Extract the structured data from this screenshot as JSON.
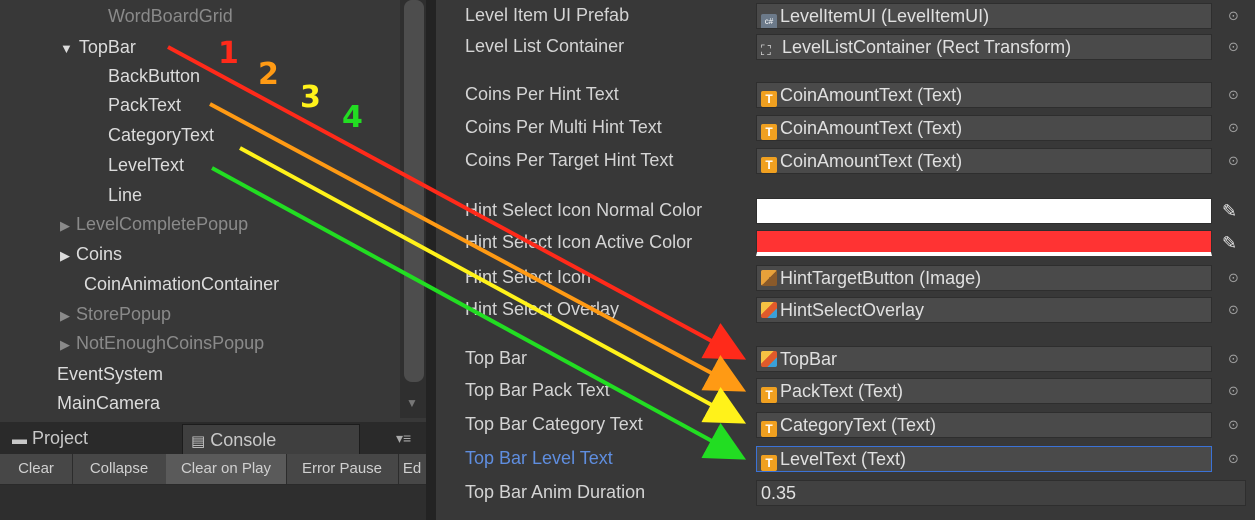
{
  "hierarchy": {
    "items": [
      {
        "label": "WordBoardGrid",
        "dim": true
      },
      {
        "label": "TopBar"
      },
      {
        "label": "BackButton"
      },
      {
        "label": "PackText"
      },
      {
        "label": "CategoryText"
      },
      {
        "label": "LevelText"
      },
      {
        "label": "Line"
      },
      {
        "label": "LevelCompletePopup",
        "dim": true
      },
      {
        "label": "Coins"
      },
      {
        "label": "CoinAnimationContainer"
      },
      {
        "label": "StorePopup",
        "dim": true
      },
      {
        "label": "NotEnoughCoinsPopup",
        "dim": true
      },
      {
        "label": "EventSystem"
      },
      {
        "label": "MainCamera"
      }
    ]
  },
  "tabs": {
    "project": "Project",
    "console": "Console"
  },
  "console_toolbar": [
    "Clear",
    "Collapse",
    "Clear on Play",
    "Error Pause",
    "Ed"
  ],
  "inspector": {
    "rows": [
      {
        "label": "Level Item UI Prefab",
        "value": "LevelItemUI (LevelItemUI)",
        "icon": "cs-script-icon"
      },
      {
        "label": "Level List Container",
        "value": "LevelListContainer (Rect Transform)",
        "icon": "rect-transform-icon"
      },
      {
        "label": "Coins Per Hint Text",
        "value": "CoinAmountText (Text)",
        "icon": "text-component-icon"
      },
      {
        "label": "Coins Per Multi Hint Text",
        "value": "CoinAmountText (Text)",
        "icon": "text-component-icon"
      },
      {
        "label": "Coins Per Target Hint Text",
        "value": "CoinAmountText (Text)",
        "icon": "text-component-icon"
      },
      {
        "label": "Hint Select Icon Normal Color",
        "color": "#ffffff"
      },
      {
        "label": "Hint Select Icon Active Color",
        "color": "#ff3333"
      },
      {
        "label": "Hint Select Icon",
        "value": "HintTargetButton (Image)",
        "icon": "image-component-icon"
      },
      {
        "label": "Hint Select Overlay",
        "value": "HintSelectOverlay",
        "icon": "gameobject-cube-icon"
      },
      {
        "label": "Top Bar",
        "value": "TopBar",
        "icon": "gameobject-cube-icon"
      },
      {
        "label": "Top Bar Pack Text",
        "value": "PackText (Text)",
        "icon": "text-component-icon"
      },
      {
        "label": "Top Bar Category Text",
        "value": "CategoryText (Text)",
        "icon": "text-component-icon"
      },
      {
        "label": "Top Bar Level Text",
        "value": "LevelText (Text)",
        "icon": "text-component-icon"
      },
      {
        "label": "Top Bar Anim Duration",
        "value": "0.35"
      }
    ]
  },
  "annotations": {
    "numbers": [
      "1",
      "2",
      "3",
      "4"
    ],
    "colors": [
      "#ff2a1a",
      "#ff9a14",
      "#fff21a",
      "#22dd22"
    ]
  }
}
